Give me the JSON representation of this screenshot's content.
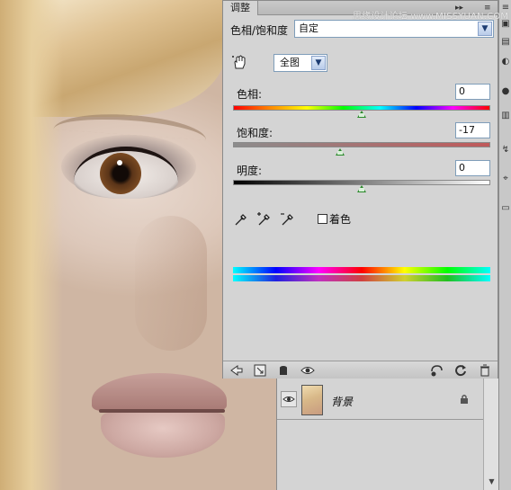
{
  "panel": {
    "tab_title": "调整",
    "preset_label": "色相/饱和度",
    "preset_value": "自定",
    "channel_value": "全图",
    "hue": {
      "label": "色相:",
      "value": "0",
      "level": 0.5
    },
    "saturation": {
      "label": "饱和度:",
      "value": "-17",
      "level": 0.415
    },
    "lightness": {
      "label": "明度:",
      "value": "0",
      "level": 0.5
    },
    "colorize_label": "着色",
    "colorize_checked": false
  },
  "layers": {
    "items": [
      {
        "name": "背景",
        "visible": true,
        "locked": true
      }
    ]
  },
  "watermark": "思缘设计论坛 www.MISSYUAN.COM"
}
